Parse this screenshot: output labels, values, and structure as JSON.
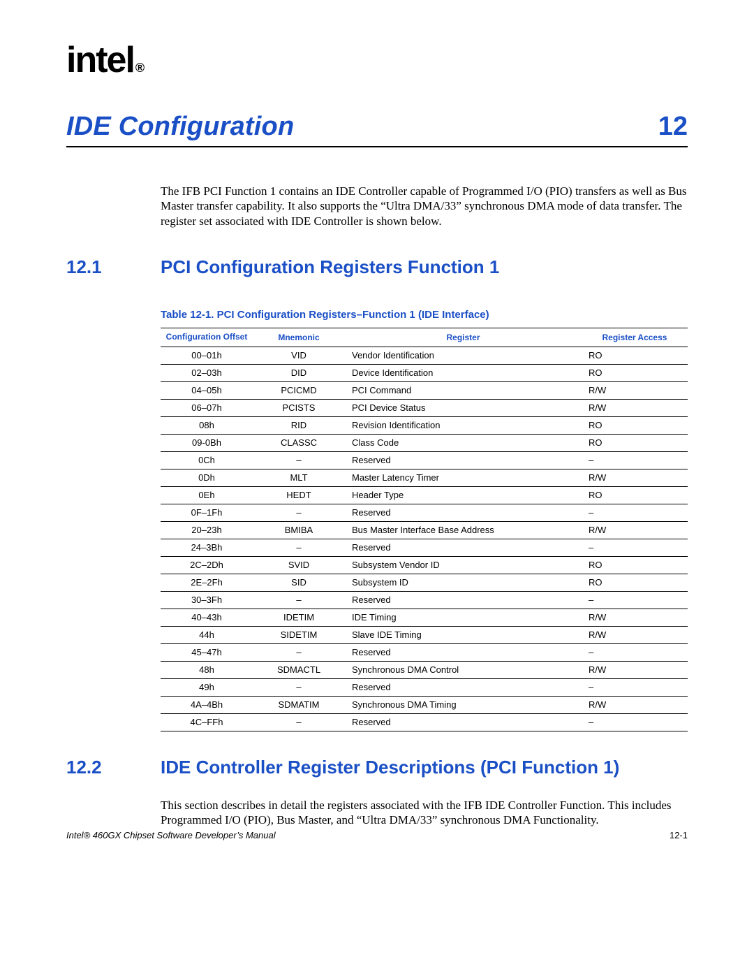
{
  "logo": "intel",
  "logo_suffix": "®",
  "chapter": {
    "title": "IDE Configuration",
    "number": "12"
  },
  "intro": "The IFB PCI Function 1 contains an IDE Controller capable of Programmed I/O (PIO) transfers as well as Bus Master transfer capability. It also supports the “Ultra DMA/33” synchronous DMA mode of data transfer. The register set associated with IDE Controller is shown below.",
  "section1": {
    "num": "12.1",
    "title": "PCI Configuration Registers Function 1"
  },
  "table": {
    "caption": "Table 12-1. PCI Configuration Registers–Function 1 (IDE Interface)",
    "headers": {
      "c1": "Configuration Offset",
      "c2": "Mnemonic",
      "c3": "Register",
      "c4": "Register Access"
    },
    "rows": [
      {
        "c1": "00–01h",
        "c2": "VID",
        "c3": "Vendor Identification",
        "c4": "RO"
      },
      {
        "c1": "02–03h",
        "c2": "DID",
        "c3": "Device Identification",
        "c4": "RO"
      },
      {
        "c1": "04–05h",
        "c2": "PCICMD",
        "c3": "PCI Command",
        "c4": "R/W"
      },
      {
        "c1": "06–07h",
        "c2": "PCISTS",
        "c3": "PCI Device Status",
        "c4": "R/W"
      },
      {
        "c1": "08h",
        "c2": "RID",
        "c3": "Revision Identification",
        "c4": "RO"
      },
      {
        "c1": "09-0Bh",
        "c2": "CLASSC",
        "c3": "Class Code",
        "c4": "RO"
      },
      {
        "c1": "0Ch",
        "c2": "–",
        "c3": "Reserved",
        "c4": "–"
      },
      {
        "c1": "0Dh",
        "c2": "MLT",
        "c3": "Master Latency Timer",
        "c4": "R/W"
      },
      {
        "c1": "0Eh",
        "c2": "HEDT",
        "c3": "Header Type",
        "c4": "RO"
      },
      {
        "c1": "0F–1Fh",
        "c2": "–",
        "c3": "Reserved",
        "c4": "–"
      },
      {
        "c1": "20–23h",
        "c2": "BMIBA",
        "c3": "Bus Master Interface Base Address",
        "c4": "R/W"
      },
      {
        "c1": "24–3Bh",
        "c2": "–",
        "c3": "Reserved",
        "c4": "–"
      },
      {
        "c1": "2C–2Dh",
        "c2": "SVID",
        "c3": "Subsystem Vendor ID",
        "c4": "RO"
      },
      {
        "c1": "2E–2Fh",
        "c2": "SID",
        "c3": "Subsystem ID",
        "c4": "RO"
      },
      {
        "c1": "30–3Fh",
        "c2": "–",
        "c3": "Reserved",
        "c4": "–"
      },
      {
        "c1": "40–43h",
        "c2": "IDETIM",
        "c3": "IDE Timing",
        "c4": "R/W"
      },
      {
        "c1": "44h",
        "c2": "SIDETIM",
        "c3": "Slave IDE Timing",
        "c4": "R/W"
      },
      {
        "c1": "45–47h",
        "c2": "–",
        "c3": "Reserved",
        "c4": "–"
      },
      {
        "c1": "48h",
        "c2": "SDMACTL",
        "c3": "Synchronous DMA Control",
        "c4": "R/W"
      },
      {
        "c1": "49h",
        "c2": "–",
        "c3": "Reserved",
        "c4": "–"
      },
      {
        "c1": "4A–4Bh",
        "c2": "SDMATIM",
        "c3": "Synchronous DMA Timing",
        "c4": "R/W"
      },
      {
        "c1": "4C–FFh",
        "c2": "–",
        "c3": "Reserved",
        "c4": "–"
      }
    ]
  },
  "section2": {
    "num": "12.2",
    "title": "IDE Controller Register Descriptions (PCI Function 1)",
    "para": "This section describes in detail the registers associated with the IFB IDE Controller Function. This includes Programmed I/O (PIO), Bus Master, and “Ultra DMA/33” synchronous DMA Functionality."
  },
  "footer": {
    "left": "Intel® 460GX Chipset Software Developer’s Manual",
    "right": "12-1"
  }
}
